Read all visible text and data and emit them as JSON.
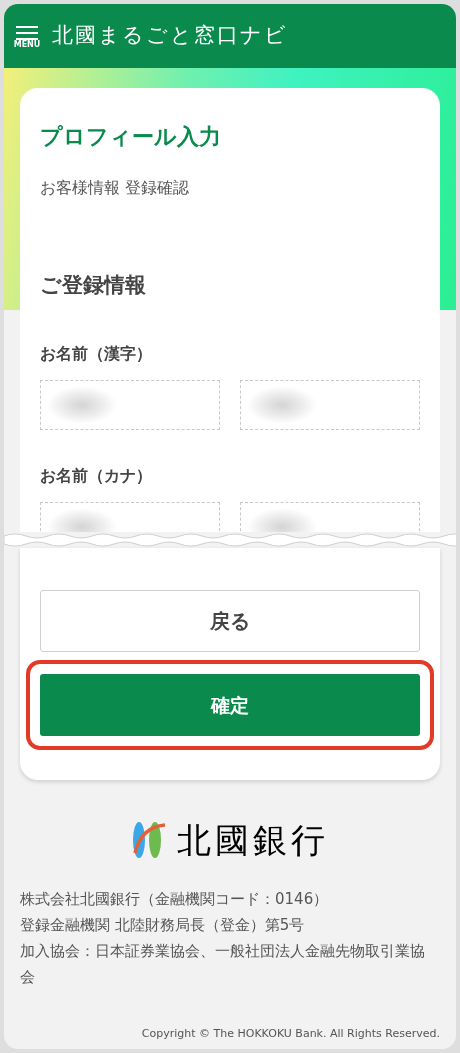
{
  "header": {
    "menu_label": "MENU",
    "title": "北國まるごと窓口ナビ"
  },
  "page": {
    "title": "プロフィール入力",
    "subtitle": "お客様情報 登録確認"
  },
  "section": {
    "title": "ご登録情報",
    "fields": [
      {
        "label": "お名前（漢字）"
      },
      {
        "label": "お名前（カナ）"
      }
    ]
  },
  "buttons": {
    "back": {
      "label": "戻る"
    },
    "confirm": {
      "label": "確定",
      "highlighted": true
    }
  },
  "footer": {
    "logo_text": "北國銀行",
    "lines": [
      "株式会社北國銀行（金融機関コード：0146）",
      "登録金融機関 北陸財務局長（登金）第5号",
      "加入協会：日本証券業協会、一般社団法人金融先物取引業協会"
    ],
    "copyright": "Copyright © The HOKKOKU Bank. All Rights Reserved."
  }
}
